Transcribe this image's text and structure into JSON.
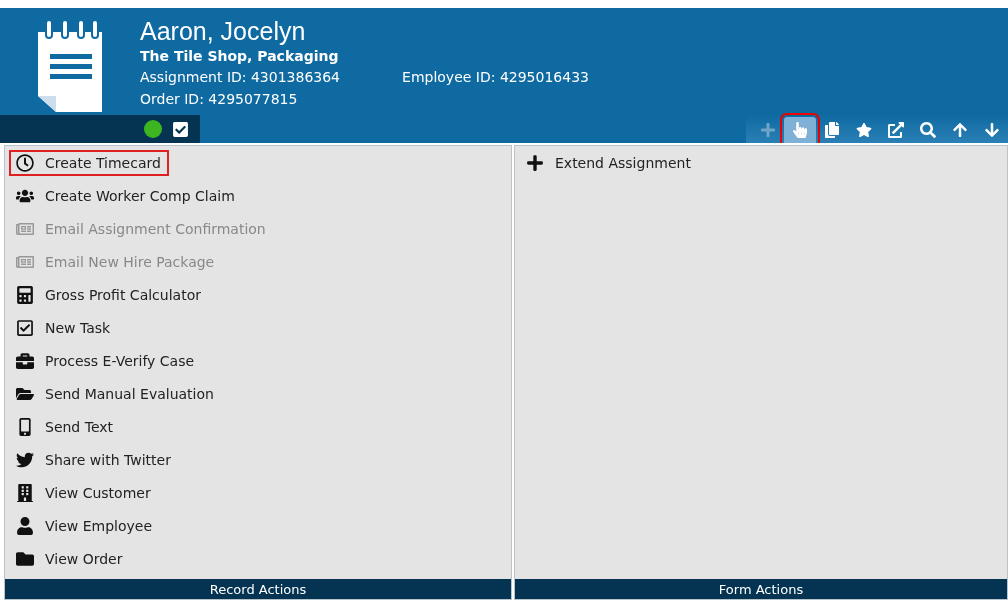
{
  "record": {
    "name": "Aaron, Jocelyn",
    "subtitle": "The Tile Shop, Packaging",
    "assignment_id": "Assignment ID: 4301386364",
    "employee_id": "Employee ID: 4295016433",
    "order_id": "Order ID: 4295077815"
  },
  "status": {
    "color": "#3cb521",
    "checked": true
  },
  "toolbar": [
    {
      "kind": "add",
      "disabled": true,
      "selected": false,
      "highlighted": false
    },
    {
      "kind": "pointer",
      "disabled": false,
      "selected": true,
      "highlighted": true
    },
    {
      "kind": "copy",
      "disabled": false,
      "selected": false,
      "highlighted": false
    },
    {
      "kind": "star",
      "disabled": false,
      "selected": false,
      "highlighted": false
    },
    {
      "kind": "external",
      "disabled": false,
      "selected": false,
      "highlighted": false
    },
    {
      "kind": "search",
      "disabled": false,
      "selected": false,
      "highlighted": false
    },
    {
      "kind": "up",
      "disabled": false,
      "selected": false,
      "highlighted": false
    },
    {
      "kind": "down",
      "disabled": false,
      "selected": false,
      "highlighted": false
    }
  ],
  "record_actions": {
    "title": "Record Actions",
    "items": [
      {
        "label": "Create Timecard",
        "kind": "clock",
        "disabled": false,
        "highlighted": true
      },
      {
        "label": "Create Worker Comp Claim",
        "kind": "people",
        "disabled": false,
        "highlighted": false
      },
      {
        "label": "Email Assignment Confirmation",
        "kind": "newsletter",
        "disabled": true,
        "highlighted": false
      },
      {
        "label": "Email New Hire Package",
        "kind": "newsletter",
        "disabled": true,
        "highlighted": false
      },
      {
        "label": "Gross Profit Calculator",
        "kind": "calculator",
        "disabled": false,
        "highlighted": false
      },
      {
        "label": "New Task",
        "kind": "checkbox",
        "disabled": false,
        "highlighted": false
      },
      {
        "label": "Process E-Verify Case",
        "kind": "briefcase",
        "disabled": false,
        "highlighted": false
      },
      {
        "label": "Send Manual Evaluation",
        "kind": "folder-open",
        "disabled": false,
        "highlighted": false
      },
      {
        "label": "Send Text",
        "kind": "phone",
        "disabled": false,
        "highlighted": false
      },
      {
        "label": "Share with Twitter",
        "kind": "twitter",
        "disabled": false,
        "highlighted": false
      },
      {
        "label": "View Customer",
        "kind": "building",
        "disabled": false,
        "highlighted": false
      },
      {
        "label": "View Employee",
        "kind": "person",
        "disabled": false,
        "highlighted": false
      },
      {
        "label": "View Order",
        "kind": "folder",
        "disabled": false,
        "highlighted": false
      }
    ]
  },
  "form_actions": {
    "title": "Form Actions",
    "items": [
      {
        "label": "Extend Assignment",
        "kind": "plus",
        "disabled": false,
        "highlighted": false
      }
    ]
  }
}
